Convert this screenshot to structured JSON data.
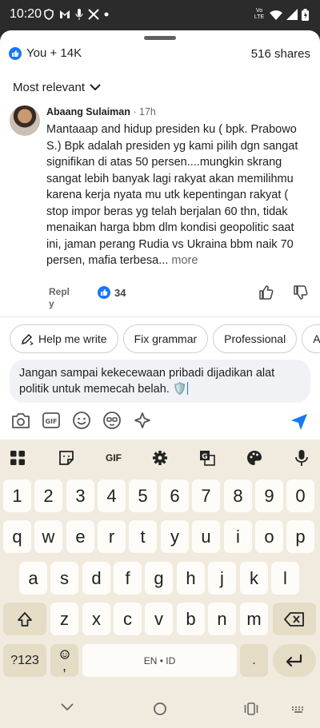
{
  "status_bar": {
    "time": "10:20",
    "network_label": "Vo LTE"
  },
  "reactions": {
    "summary": "You + 14K",
    "shares": "516 shares"
  },
  "sort": {
    "label": "Most relevant"
  },
  "comment": {
    "author": "Abaang Sulaiman",
    "time": "· 17h",
    "text": "Mantaaap and hidup presiden ku ( bpk. Prabowo S.) Bpk adalah presiden yg kami pilih dgn sangat signifikan di atas 50 persen....mungkin skrang sangat lebih banyak lagi rakyat akan memilihmu karena kerja nyata mu utk kepentingan rakyat ( stop impor beras yg telah berjalan 60 thn, tidak menaikan harga bbm dlm kondisi geopolitic saat ini, jaman perang Rudia vs Ukraina bbm naik 70 persen, mafia terbesa...",
    "more_label": "more",
    "reply_label": "Reply",
    "like_count": "34"
  },
  "chips": [
    "Help me write",
    "Fix grammar",
    "Professional",
    "A"
  ],
  "input": {
    "value": "Jangan sampai kekecewaan pribadi dijadikan alat politik untuk memecah belah. 🛡️"
  },
  "keyboard": {
    "gif_label": "GIF",
    "row_numbers": [
      "1",
      "2",
      "3",
      "4",
      "5",
      "6",
      "7",
      "8",
      "9",
      "0"
    ],
    "row_1": [
      "q",
      "w",
      "e",
      "r",
      "t",
      "y",
      "u",
      "i",
      "o",
      "p"
    ],
    "row_2": [
      "a",
      "s",
      "d",
      "f",
      "g",
      "h",
      "j",
      "k",
      "l"
    ],
    "row_3": [
      "z",
      "x",
      "c",
      "v",
      "b",
      "n",
      "m"
    ],
    "symbols_label": "?123",
    "comma_label": ",",
    "space_label": "EN • ID",
    "period_label": "."
  },
  "colors": {
    "brand_blue": "#1877f2",
    "keyboard_bg": "#f1ebdf",
    "key_bg": "#fefcf8",
    "mod_key_bg": "#e5dcc6"
  }
}
